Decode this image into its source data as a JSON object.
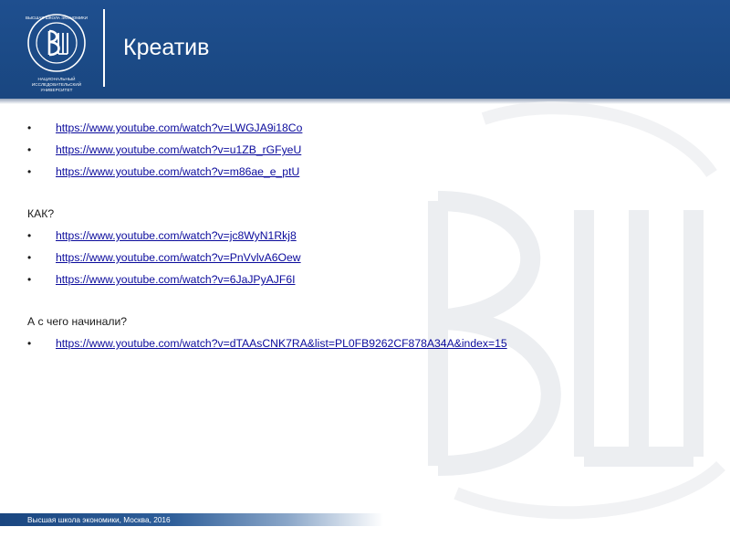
{
  "header": {
    "title": "Креатив",
    "logo_caption_line1": "НАЦИОНАЛЬНЫЙ ИССЛЕДОВАТЕЛЬСКИЙ",
    "logo_caption_line2": "УНИВЕРСИТЕТ",
    "logo_ring_text": "ВЫСШАЯ ШКОЛА ЭКОНОМИКИ",
    "background_color": "#1b4a86"
  },
  "group1": {
    "links": [
      "https://www.youtube.com/watch?v=LWGJA9i18Co",
      "https://www.youtube.com/watch?v=u1ZB_rGFyeU",
      "https://www.youtube.com/watch?v=m86ae_e_ptU"
    ]
  },
  "group2": {
    "heading": "КАК?",
    "links": [
      "https://www.youtube.com/watch?v=jc8WyN1Rkj8",
      "https://www.youtube.com/watch?v=PnVvlvA6Oew",
      "https://www.youtube.com/watch?v=6JaJPyAJF6I"
    ]
  },
  "group3": {
    "heading": "А с чего начинали?",
    "links": [
      "https://www.youtube.com/watch?v=dTAAsCNK7RA&list=PL0FB9262CF878A34A&index=15"
    ]
  },
  "bullet_glyph": "•",
  "footer": {
    "text": "Высшая школа экономики, Москва, 2016"
  },
  "colors": {
    "link": "#0b0b9c",
    "header": "#1b4a86",
    "watermark": "#e8eaed"
  }
}
